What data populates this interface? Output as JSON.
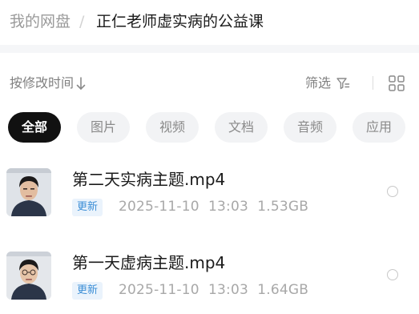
{
  "breadcrumb": {
    "root": "我的网盘",
    "separator": "/",
    "current": "正仁老师虚实病的公益课"
  },
  "toolbar": {
    "sort_label": "按修改时间",
    "filter_label": "筛选",
    "sort_icon": "arrow-down-icon",
    "filter_icon": "funnel-icon",
    "view_icon": "grid-view-icon"
  },
  "tabs": [
    {
      "label": "全部",
      "active": true
    },
    {
      "label": "图片",
      "active": false
    },
    {
      "label": "视频",
      "active": false
    },
    {
      "label": "文档",
      "active": false
    },
    {
      "label": "音频",
      "active": false
    },
    {
      "label": "应用",
      "active": false
    }
  ],
  "files": [
    {
      "name": "第二天实病主题.mp4",
      "badge": "更新",
      "date": "2025-11-10",
      "time": "13:03",
      "size": "1.53GB"
    },
    {
      "name": "第一天虚病主题.mp4",
      "badge": "更新",
      "date": "2025-11-10",
      "time": "13:03",
      "size": "1.64GB"
    }
  ],
  "colors": {
    "active_tab_bg": "#111111",
    "badge_text": "#3d8fd6",
    "badge_bg": "#eaf3fc"
  }
}
